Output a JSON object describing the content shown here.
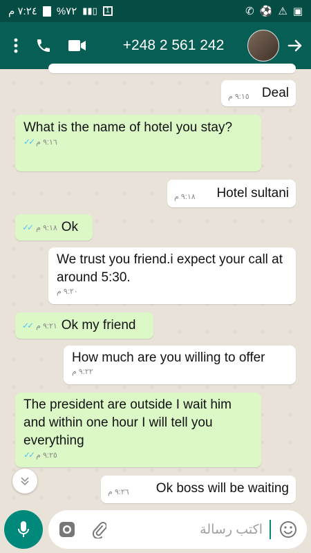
{
  "status_bar": {
    "time": "٧:٢٤ م",
    "battery": "%٧٢",
    "sim": "1"
  },
  "header": {
    "contact": "+248 2 561 242"
  },
  "messages": [
    {
      "dir": "in",
      "text": "Deal",
      "time": "٩:١٥ م"
    },
    {
      "dir": "out",
      "text": "What is the name of hotel you stay?",
      "time": "٩:١٦ م"
    },
    {
      "dir": "in",
      "text": "Hotel sultani",
      "time": "٩:١٨ م"
    },
    {
      "dir": "out",
      "text": "Ok",
      "time": "٩:١٨ م"
    },
    {
      "dir": "in",
      "text": "We trust you friend.i expect your call at around 5:30.",
      "time": "٩:٢٠ م"
    },
    {
      "dir": "out",
      "text": "Ok my friend",
      "time": "٩:٢١ م"
    },
    {
      "dir": "in",
      "text": "How much are you willing to offer",
      "time": "٩:٢٢ م"
    },
    {
      "dir": "out",
      "text": "The president are outside I wait him and within one hour I will tell you everything",
      "time": "٩:٢٥ م"
    },
    {
      "dir": "in",
      "text": "Ok boss will be waiting",
      "time": "٩:٢٦ م"
    }
  ],
  "input": {
    "placeholder": "اكتب رسالة"
  },
  "colors": {
    "header": "#075e54",
    "status_bar": "#054d44",
    "outgoing_bubble": "#dcf8c6",
    "incoming_bubble": "#ffffff",
    "read_ticks": "#4fc3f7",
    "mic_button": "#00897b"
  },
  "icons": [
    "more-vert-icon",
    "phone-icon",
    "video-icon",
    "back-arrow-icon",
    "double-chevron-down-icon",
    "mic-icon",
    "camera-icon",
    "attachment-icon",
    "emoji-icon"
  ]
}
